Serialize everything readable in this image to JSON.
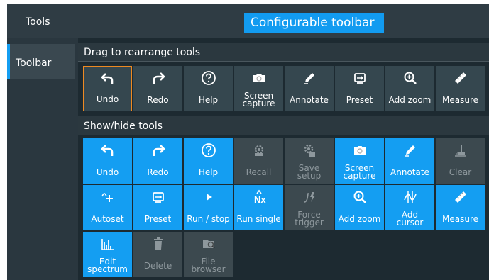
{
  "header": {
    "tools_label": "Tools",
    "configurable_label": "Configurable toolbar"
  },
  "sidebar": {
    "tabs": [
      {
        "label": "Toolbar"
      }
    ]
  },
  "sections": {
    "arrange": {
      "heading": "Drag to rearrange tools"
    },
    "showhide": {
      "heading": "Show/hide tools"
    }
  },
  "toolbar_tools": [
    {
      "label": "Undo",
      "icon": "undo-icon",
      "selected": true
    },
    {
      "label": "Redo",
      "icon": "redo-icon"
    },
    {
      "label": "Help",
      "icon": "help-icon"
    },
    {
      "label": "Screen\ncapture",
      "icon": "camera-icon"
    },
    {
      "label": "Annotate",
      "icon": "pen-icon"
    },
    {
      "label": "Preset",
      "icon": "preset-icon"
    },
    {
      "label": "Add zoom",
      "icon": "zoom-icon"
    },
    {
      "label": "Measure",
      "icon": "ruler-icon"
    }
  ],
  "all_tools": [
    {
      "label": "Undo",
      "icon": "undo-icon",
      "shown": true
    },
    {
      "label": "Redo",
      "icon": "redo-icon",
      "shown": true
    },
    {
      "label": "Help",
      "icon": "help-icon",
      "shown": true
    },
    {
      "label": "Recall",
      "icon": "recall-icon",
      "shown": false
    },
    {
      "label": "Save\nsetup",
      "icon": "save-setup-icon",
      "shown": false
    },
    {
      "label": "Screen\ncapture",
      "icon": "camera-icon",
      "shown": true
    },
    {
      "label": "Annotate",
      "icon": "pen-icon",
      "shown": true
    },
    {
      "label": "Clear",
      "icon": "clear-icon",
      "shown": false
    },
    {
      "label": "Autoset",
      "icon": "autoset-icon",
      "shown": true
    },
    {
      "label": "Preset",
      "icon": "preset-icon",
      "shown": true
    },
    {
      "label": "Run / stop",
      "icon": "play-icon",
      "shown": true
    },
    {
      "label": "Run single",
      "icon": "run-single-icon",
      "shown": true
    },
    {
      "label": "Force\ntrigger",
      "icon": "force-trigger-icon",
      "shown": false
    },
    {
      "label": "Add zoom",
      "icon": "zoom-icon",
      "shown": true
    },
    {
      "label": "Add\ncursor",
      "icon": "cursor-icon",
      "shown": true
    },
    {
      "label": "Measure",
      "icon": "ruler-icon",
      "shown": true
    },
    {
      "label": "Edit\nspectrum",
      "icon": "spectrum-icon",
      "shown": true
    },
    {
      "label": "Delete",
      "icon": "trash-icon",
      "shown": false
    },
    {
      "label": "File\nbrowser",
      "icon": "file-browser-icon",
      "shown": false
    }
  ],
  "colors": {
    "accent": "#149ef2",
    "selected_border": "#ee8a22",
    "inactive_text": "#8e989d"
  }
}
